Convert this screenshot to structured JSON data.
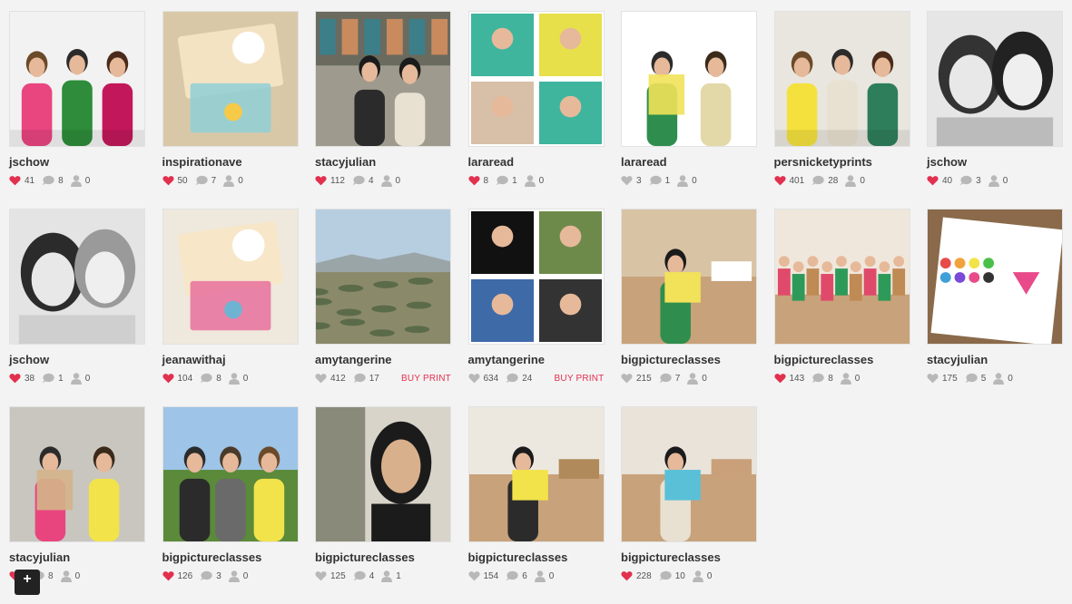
{
  "posts": [
    {
      "user": "jschow",
      "likes": "41",
      "comments": "8",
      "regrams": "0",
      "liked": true,
      "buy": "",
      "photo": {
        "bg": "#f2f2f2",
        "scene": "group",
        "colors": [
          "#e9457f",
          "#2e8c3a",
          "#c2185b"
        ]
      }
    },
    {
      "user": "inspirationave",
      "likes": "50",
      "comments": "7",
      "regrams": "0",
      "liked": true,
      "buy": "",
      "photo": {
        "bg": "#d9c8a8",
        "scene": "craft",
        "colors": [
          "#f4e3c3",
          "#8fd0d6",
          "#f7c948"
        ]
      }
    },
    {
      "user": "stacyjulian",
      "likes": "112",
      "comments": "4",
      "regrams": "0",
      "liked": true,
      "buy": "",
      "photo": {
        "bg": "#9e9a8e",
        "scene": "shop",
        "colors": [
          "#3c7f89",
          "#2b2b2b",
          "#c98a5e"
        ]
      }
    },
    {
      "user": "lararead",
      "likes": "8",
      "comments": "1",
      "regrams": "0",
      "liked": true,
      "buy": "",
      "photo": {
        "bg": "#ffffff",
        "scene": "collage",
        "colors": [
          "#3fb59e",
          "#e8e04a",
          "#d7bfa8",
          "#3fb59e"
        ]
      }
    },
    {
      "user": "lararead",
      "likes": "3",
      "comments": "1",
      "regrams": "0",
      "liked": false,
      "buy": "",
      "photo": {
        "bg": "#ffffff",
        "scene": "duo",
        "colors": [
          "#2f8e4d",
          "#e3d9a8",
          "#f1e25a"
        ]
      }
    },
    {
      "user": "persnicketyprints",
      "likes": "401",
      "comments": "28",
      "regrams": "0",
      "liked": true,
      "buy": "",
      "photo": {
        "bg": "#e9e6df",
        "scene": "group",
        "colors": [
          "#f4e13d",
          "#e8e0d0",
          "#2e7d5b"
        ]
      }
    },
    {
      "user": "jschow",
      "likes": "40",
      "comments": "3",
      "regrams": "0",
      "liked": true,
      "buy": "",
      "photo": {
        "bg": "#e6e6e6",
        "scene": "selfie",
        "colors": [
          "#333333",
          "#222222",
          "#bbbbbb"
        ]
      }
    },
    {
      "user": "jschow",
      "likes": "38",
      "comments": "1",
      "regrams": "0",
      "liked": true,
      "buy": "",
      "photo": {
        "bg": "#e4e4e4",
        "scene": "selfie",
        "colors": [
          "#2b2b2b",
          "#9a9a9a",
          "#cfcfcf"
        ]
      }
    },
    {
      "user": "jeanawithaj",
      "likes": "104",
      "comments": "8",
      "regrams": "0",
      "liked": true,
      "buy": "",
      "photo": {
        "bg": "#efe8dc",
        "scene": "craft",
        "colors": [
          "#f7e7c8",
          "#e8709d",
          "#6fb3d2"
        ]
      }
    },
    {
      "user": "amytangerine",
      "likes": "412",
      "comments": "17",
      "regrams": "",
      "liked": false,
      "buy": "BUY PRINT",
      "photo": {
        "bg": "#a6c5d9",
        "scene": "landscape",
        "colors": [
          "#b7cee0",
          "#8a8a6a",
          "#5b6b4a"
        ]
      }
    },
    {
      "user": "amytangerine",
      "likes": "634",
      "comments": "24",
      "regrams": "",
      "liked": false,
      "buy": "BUY PRINT",
      "photo": {
        "bg": "#ffffff",
        "scene": "collage",
        "colors": [
          "#111111",
          "#6e8a4a",
          "#3e6aa8",
          "#333333"
        ]
      }
    },
    {
      "user": "bigpictureclasses",
      "likes": "215",
      "comments": "7",
      "regrams": "0",
      "liked": false,
      "buy": "",
      "photo": {
        "bg": "#d8c3a5",
        "scene": "room",
        "colors": [
          "#2f8e4d",
          "#f1e25a",
          "#ffffff"
        ]
      }
    },
    {
      "user": "bigpictureclasses",
      "likes": "143",
      "comments": "8",
      "regrams": "0",
      "liked": true,
      "buy": "",
      "photo": {
        "bg": "#efe7db",
        "scene": "crowd",
        "colors": [
          "#e04a6a",
          "#2e9a5a",
          "#c08a55"
        ]
      }
    },
    {
      "user": "stacyjulian",
      "likes": "175",
      "comments": "5",
      "regrams": "0",
      "liked": false,
      "buy": "",
      "photo": {
        "bg": "#8a6a4a",
        "scene": "paint",
        "colors": [
          "#ffffff",
          "#3fa0d8",
          "#e84a8a"
        ]
      }
    },
    {
      "user": "stacyjulian",
      "likes": "",
      "comments": "8",
      "regrams": "0",
      "liked": true,
      "buy": "",
      "photo": {
        "bg": "#c9c6bf",
        "scene": "duo",
        "colors": [
          "#e8457f",
          "#f2e34a",
          "#d4b48a"
        ]
      }
    },
    {
      "user": "bigpictureclasses",
      "likes": "126",
      "comments": "3",
      "regrams": "0",
      "liked": true,
      "buy": "",
      "photo": {
        "bg": "#9ec4e8",
        "scene": "outdoor",
        "colors": [
          "#5a8a3a",
          "#2b2b2b",
          "#f2e34a"
        ]
      }
    },
    {
      "user": "bigpictureclasses",
      "likes": "125",
      "comments": "4",
      "regrams": "1",
      "liked": false,
      "buy": "",
      "photo": {
        "bg": "#d8d4ca",
        "scene": "portrait",
        "colors": [
          "#1b1b1b",
          "#d9b08c",
          "#8a8a7a"
        ]
      }
    },
    {
      "user": "bigpictureclasses",
      "likes": "154",
      "comments": "6",
      "regrams": "0",
      "liked": false,
      "buy": "",
      "photo": {
        "bg": "#ece8e0",
        "scene": "room",
        "colors": [
          "#2b2b2b",
          "#f2e34a",
          "#b08a5a"
        ]
      }
    },
    {
      "user": "bigpictureclasses",
      "likes": "228",
      "comments": "10",
      "regrams": "0",
      "liked": true,
      "buy": "",
      "photo": {
        "bg": "#e9e3d9",
        "scene": "room",
        "colors": [
          "#e8e0d0",
          "#5ac0d8",
          "#c9a07a"
        ]
      }
    }
  ],
  "icons": {
    "like": "heart-icon",
    "comment": "comment-bubble-icon",
    "regram": "person-icon",
    "add": "plus-icon"
  },
  "colors": {
    "liked": "#e2304f",
    "unliked": "#b8b8b8",
    "buy": "#e2304f",
    "text": "#333333"
  },
  "floating_button": {
    "label": "+"
  }
}
